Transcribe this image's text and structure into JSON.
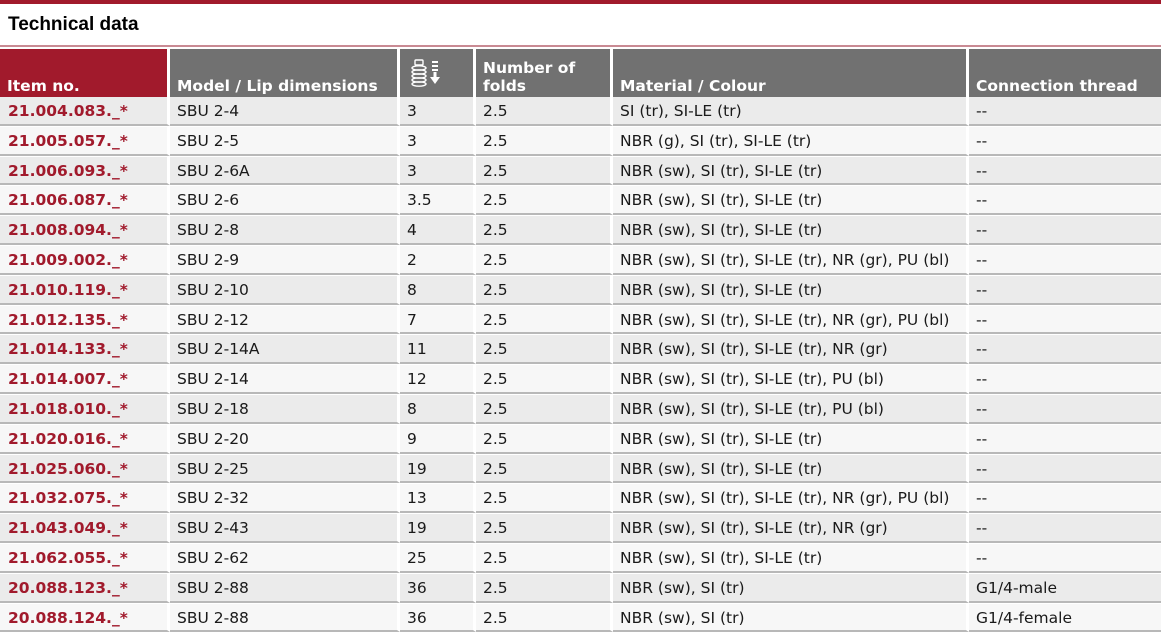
{
  "title": "Technical data",
  "colors": {
    "accent": "#a11a2c",
    "header_gray": "#717171"
  },
  "table": {
    "headers": {
      "item_no": "Item no.",
      "model": "Model / Lip dimensions",
      "folds_icon": "bellows-height-icon",
      "number_of_folds_line1": "Number of",
      "number_of_folds_line2": "folds",
      "material": "Material / Colour",
      "thread": "Connection thread"
    },
    "rows": [
      {
        "item": "21.004.083._*",
        "model": "SBU 2-4",
        "col3": "3",
        "folds": "2.5",
        "material": "SI (tr), SI-LE (tr)",
        "thread": "--"
      },
      {
        "item": "21.005.057._*",
        "model": "SBU 2-5",
        "col3": "3",
        "folds": "2.5",
        "material": "NBR (g), SI (tr), SI-LE (tr)",
        "thread": "--"
      },
      {
        "item": "21.006.093._*",
        "model": "SBU 2-6A",
        "col3": "3",
        "folds": "2.5",
        "material": "NBR (sw), SI (tr), SI-LE (tr)",
        "thread": "--"
      },
      {
        "item": "21.006.087._*",
        "model": "SBU 2-6",
        "col3": "3.5",
        "folds": "2.5",
        "material": "NBR (sw), SI (tr), SI-LE (tr)",
        "thread": "--"
      },
      {
        "item": "21.008.094._*",
        "model": "SBU 2-8",
        "col3": "4",
        "folds": "2.5",
        "material": "NBR (sw), SI (tr), SI-LE (tr)",
        "thread": "--"
      },
      {
        "item": "21.009.002._*",
        "model": "SBU 2-9",
        "col3": "2",
        "folds": "2.5",
        "material": "NBR (sw), SI (tr), SI-LE (tr), NR (gr), PU (bl)",
        "thread": "--"
      },
      {
        "item": "21.010.119._*",
        "model": "SBU 2-10",
        "col3": "8",
        "folds": "2.5",
        "material": "NBR (sw), SI (tr), SI-LE (tr)",
        "thread": "--"
      },
      {
        "item": "21.012.135._*",
        "model": "SBU 2-12",
        "col3": "7",
        "folds": "2.5",
        "material": "NBR (sw), SI (tr), SI-LE (tr), NR (gr), PU (bl)",
        "thread": "--"
      },
      {
        "item": "21.014.133._*",
        "model": "SBU 2-14A",
        "col3": "11",
        "folds": "2.5",
        "material": "NBR (sw), SI (tr), SI-LE (tr), NR (gr)",
        "thread": "--"
      },
      {
        "item": "21.014.007._*",
        "model": "SBU 2-14",
        "col3": "12",
        "folds": "2.5",
        "material": "NBR (sw), SI (tr), SI-LE (tr), PU (bl)",
        "thread": "--"
      },
      {
        "item": "21.018.010._*",
        "model": "SBU 2-18",
        "col3": "8",
        "folds": "2.5",
        "material": "NBR (sw), SI (tr), SI-LE (tr), PU (bl)",
        "thread": "--"
      },
      {
        "item": "21.020.016._*",
        "model": "SBU 2-20",
        "col3": "9",
        "folds": "2.5",
        "material": "NBR (sw), SI (tr), SI-LE (tr)",
        "thread": "--"
      },
      {
        "item": "21.025.060._*",
        "model": "SBU 2-25",
        "col3": "19",
        "folds": "2.5",
        "material": "NBR (sw), SI (tr), SI-LE (tr)",
        "thread": "--"
      },
      {
        "item": "21.032.075._*",
        "model": "SBU 2-32",
        "col3": "13",
        "folds": "2.5",
        "material": "NBR (sw), SI (tr), SI-LE (tr), NR (gr), PU (bl)",
        "thread": "--"
      },
      {
        "item": "21.043.049._*",
        "model": "SBU 2-43",
        "col3": "19",
        "folds": "2.5",
        "material": "NBR (sw), SI (tr), SI-LE (tr), NR (gr)",
        "thread": "--"
      },
      {
        "item": "21.062.055._*",
        "model": "SBU 2-62",
        "col3": "25",
        "folds": "2.5",
        "material": "NBR (sw), SI (tr), SI-LE (tr)",
        "thread": "--"
      },
      {
        "item": "20.088.123._*",
        "model": "SBU 2-88",
        "col3": "36",
        "folds": "2.5",
        "material": "NBR (sw), SI (tr)",
        "thread": "G1/4-male"
      },
      {
        "item": "20.088.124._*",
        "model": "SBU 2-88",
        "col3": "36",
        "folds": "2.5",
        "material": "NBR (sw), SI (tr)",
        "thread": "G1/4-female"
      }
    ]
  }
}
